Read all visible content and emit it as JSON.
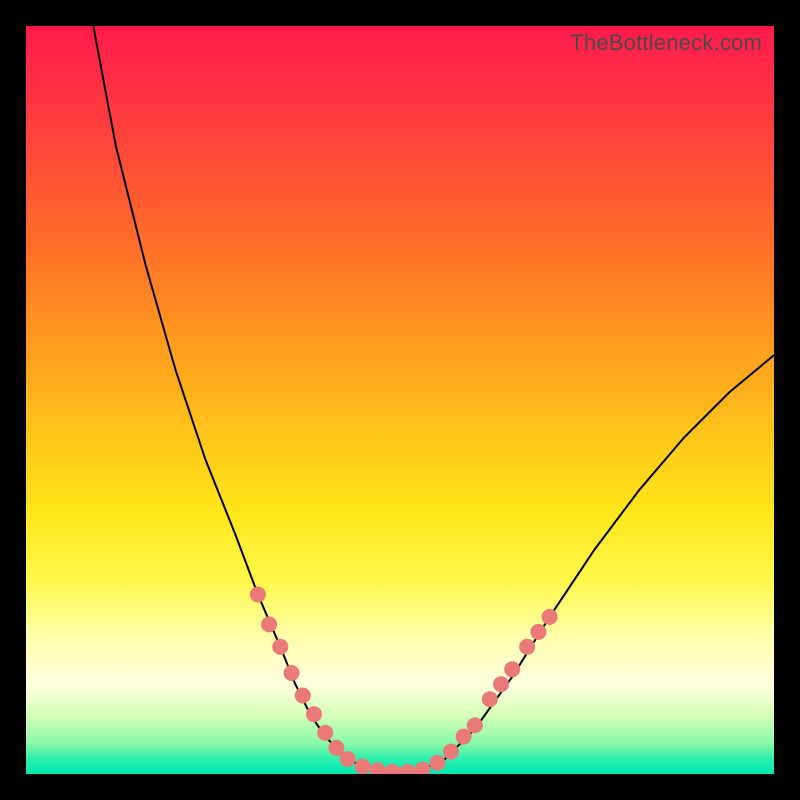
{
  "watermark": "TheBottleneck.com",
  "chart_data": {
    "type": "line",
    "title": "",
    "xlabel": "",
    "ylabel": "",
    "xlim": [
      0,
      100
    ],
    "ylim": [
      0,
      100
    ],
    "series": [
      {
        "name": "bottleneck-curve",
        "x": [
          9,
          12,
          16,
          20,
          24,
          28,
          31,
          34,
          36,
          38,
          40,
          42,
          44,
          47,
          50,
          53,
          56,
          60,
          65,
          70,
          76,
          82,
          88,
          94,
          100
        ],
        "y": [
          100,
          84,
          68,
          54,
          42,
          32,
          24,
          17,
          12,
          8,
          5,
          3,
          1.5,
          0.6,
          0.3,
          0.6,
          2,
          6,
          13,
          21,
          30,
          38,
          45,
          51,
          56
        ]
      }
    ],
    "markers": {
      "name": "highlighted-points",
      "color": "#e97a78",
      "points": [
        {
          "x": 31.0,
          "y": 24.0
        },
        {
          "x": 32.5,
          "y": 20.0
        },
        {
          "x": 34.0,
          "y": 17.0
        },
        {
          "x": 35.5,
          "y": 13.5
        },
        {
          "x": 37.0,
          "y": 10.5
        },
        {
          "x": 38.5,
          "y": 8.0
        },
        {
          "x": 40.0,
          "y": 5.5
        },
        {
          "x": 41.5,
          "y": 3.5
        },
        {
          "x": 43.0,
          "y": 2.0
        },
        {
          "x": 45.0,
          "y": 1.0
        },
        {
          "x": 47.0,
          "y": 0.5
        },
        {
          "x": 49.0,
          "y": 0.3
        },
        {
          "x": 51.0,
          "y": 0.3
        },
        {
          "x": 53.0,
          "y": 0.6
        },
        {
          "x": 55.0,
          "y": 1.5
        },
        {
          "x": 56.8,
          "y": 3.0
        },
        {
          "x": 58.5,
          "y": 5.0
        },
        {
          "x": 60.0,
          "y": 6.5
        },
        {
          "x": 62.0,
          "y": 10.0
        },
        {
          "x": 63.5,
          "y": 12.0
        },
        {
          "x": 65.0,
          "y": 14.0
        },
        {
          "x": 67.0,
          "y": 17.0
        },
        {
          "x": 68.5,
          "y": 19.0
        },
        {
          "x": 70.0,
          "y": 21.0
        }
      ]
    }
  }
}
